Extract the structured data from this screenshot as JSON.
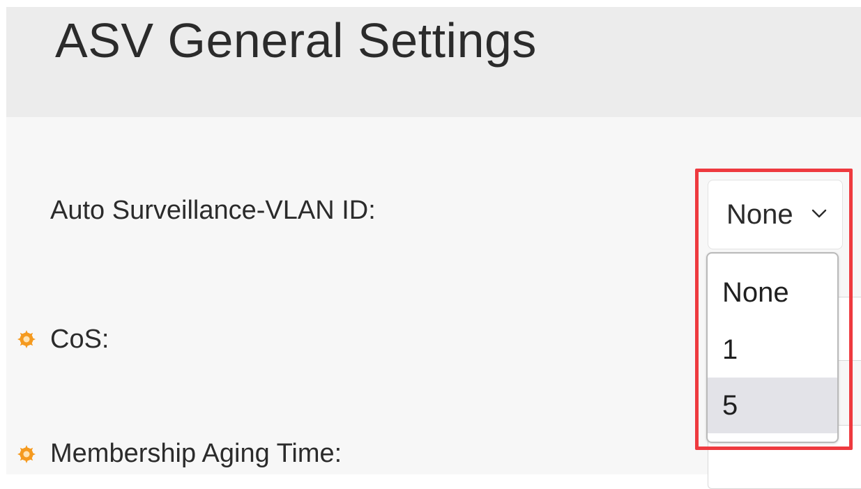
{
  "page": {
    "title": "ASV General Settings"
  },
  "fields": {
    "vlan": {
      "label": "Auto Surveillance-VLAN ID:",
      "selected_value": "None",
      "options": [
        "None",
        "1",
        "5"
      ],
      "highlighted_option": "5"
    },
    "cos": {
      "label": "CoS:",
      "required": true
    },
    "aging": {
      "label": "Membership Aging Time:",
      "required": true
    }
  },
  "icons": {
    "required": "required-field-icon",
    "dropdown": "chevron-down-icon"
  },
  "colors": {
    "annotation_border": "#ee3a3f",
    "required_icon": "#f59a1f",
    "header_bg": "#ececec",
    "option_highlight": "#e3e3e8"
  }
}
